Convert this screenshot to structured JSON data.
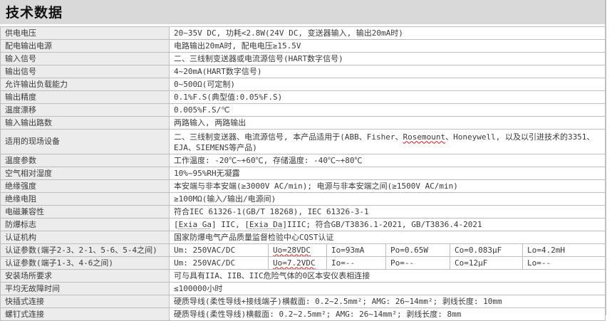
{
  "header": {
    "title": "技术数据"
  },
  "rows": [
    {
      "label": "供电电压",
      "value": "20~35V DC, 功耗<2.8W(24V DC, 变送器输入, 输出20mA时)"
    },
    {
      "label": "配电输出电源",
      "value": "电路输出20mA时, 配电电压≥15.5V"
    },
    {
      "label": "输入信号",
      "value": "二、三线制变送器或电流源信号(HART数字信号)"
    },
    {
      "label": "输出信号",
      "value": "4~20mA(HART数字信号)"
    },
    {
      "label": "允许输出负载能力",
      "value": "0~500Ω(可定制)"
    },
    {
      "label": "输出精度",
      "value": "0.1%F.S(典型值:0.05%F.S)"
    },
    {
      "label": "温度漂移",
      "value": "0.005%F.S/℃"
    },
    {
      "label": "输入输出路数",
      "value": "两路输入, 两路输出"
    },
    {
      "label": "适用的现场设备",
      "value_a": "二、三线制变送器、电流源信号, 本产品适用于(ABB、Fisher、",
      "value_b": "Rosemount",
      "value_c": "、Honeywell, 以及以引进技术的3351、EJA、SIEMENS等产品)"
    },
    {
      "label": "温度参数",
      "value": "工作温度: -20℃~+60℃, 存储温度: -40℃~+80℃"
    },
    {
      "label": "空气相对湿度",
      "value": "10%~95%RH无凝露"
    },
    {
      "label": "绝缘强度",
      "value": "本安端与非本安端(≥3000V AC/min); 电源与非本安端之间(≥1500V AC/min)"
    },
    {
      "label": "绝缘电阻",
      "value": "≥100MΩ(输入/输出/电源间)"
    },
    {
      "label": "电磁兼容性",
      "value": "符合IEC 61326-1(GB/T 18268), IEC 61326-3-1"
    },
    {
      "label": "防爆标志",
      "value_a": "[",
      "value_b": "Exia Ga",
      "value_c": "] IIC, [",
      "value_d": "Exia Da",
      "value_e": "]IIIC; 符合GB/T3836.1-2021, GB/T3836.4-2021"
    },
    {
      "label": "认证机构",
      "value": "国家防爆电气产品质量监督检验中心CQST认证"
    },
    {
      "label": "认证参数(端子2-3、2-1、5-6、5-4之间)",
      "um": "Um: 250VAC/DC",
      "uo": "Uo=28VDC",
      "io": "Io=93mA",
      "po": "Po=0.65W",
      "co": "Co=0.083μF",
      "lo": "Lo=4.2mH"
    },
    {
      "label": "认证参数(端子1-3、4-6之间)",
      "um": "Um: 250VAC/DC",
      "uo": "Uo=7.2VDC",
      "io": "Io=--",
      "po": "Po=--",
      "co": "Co=12μF",
      "lo": "Lo=--"
    },
    {
      "label": "安装场所要求",
      "value": "可与具有IIA、IIB、IIC危险气体的0区本安仪表相连接"
    },
    {
      "label": "平均无故障时间",
      "value": "≤100000小时"
    },
    {
      "label": "快插式连接",
      "value": "硬质导线(柔性导线+接线端子)横截面: 0.2~2.5mm²; AMG: 26~14mm²; 剥线长度: 10mm"
    },
    {
      "label": "螺钉式连接",
      "value": "硬质导线(柔性导线)横截面: 0.2~2.5mm²; AMG: 26~14mm²; 剥线长度: 8mm"
    }
  ]
}
